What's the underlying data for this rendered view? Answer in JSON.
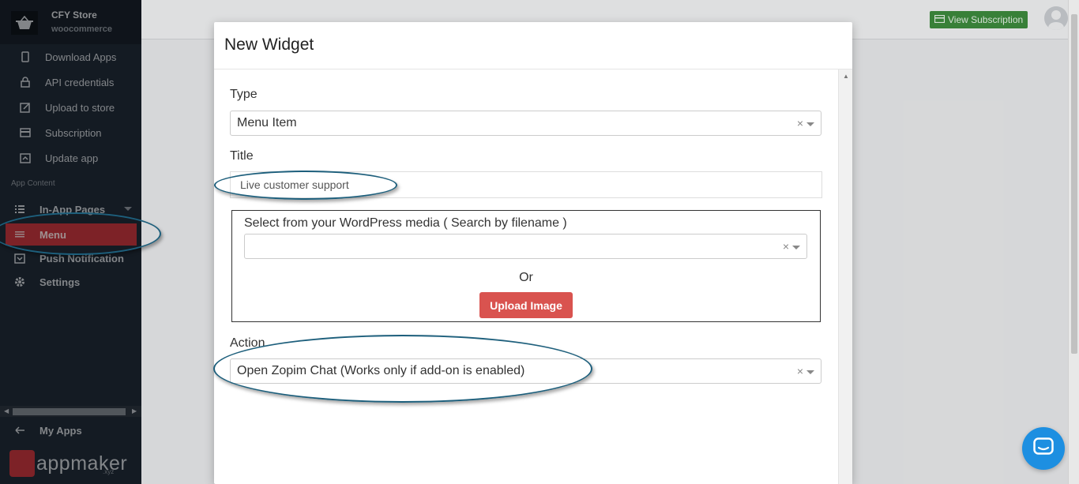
{
  "sidebar": {
    "store_name": "CFY Store",
    "store_sub": "woocommerce",
    "items": [
      {
        "label": "Download Apps",
        "icon": "phone-icon"
      },
      {
        "label": "API credentials",
        "icon": "lock-icon"
      },
      {
        "label": "Upload to store",
        "icon": "edit-icon"
      },
      {
        "label": "Subscription",
        "icon": "card-icon"
      },
      {
        "label": "Update app",
        "icon": "upload-icon"
      }
    ],
    "section_label": "App Content",
    "content_items": [
      {
        "label": "In-App Pages",
        "icon": "grid-list-icon"
      },
      {
        "label": "Menu",
        "icon": "menu-icon"
      },
      {
        "label": "Push Notification",
        "icon": "notification-icon"
      },
      {
        "label": "Settings",
        "icon": "gear-icon"
      }
    ],
    "my_apps_label": "My Apps",
    "brand_text": "appmaker",
    "brand_suffix": ".xyz",
    "active_color": "#c0353c"
  },
  "topbar": {
    "view_subscription_label": "View Subscription",
    "button_color": "#3d8b3d"
  },
  "modal": {
    "title": "New Widget",
    "type_label": "Type",
    "type_value": "Menu Item",
    "title_label": "Title",
    "title_value": "Live customer support",
    "media_label": "Select from your WordPress media ( Search by filename )",
    "media_value": "",
    "or_label": "Or",
    "upload_label": "Upload Image",
    "upload_color": "#d9534f",
    "action_label": "Action",
    "action_value": "Open Zopim Chat (Works only if add-on is enabled)",
    "clear_glyph": "×"
  },
  "annotation_color": "#1d5f7c",
  "chat_color": "#1d8fe1"
}
